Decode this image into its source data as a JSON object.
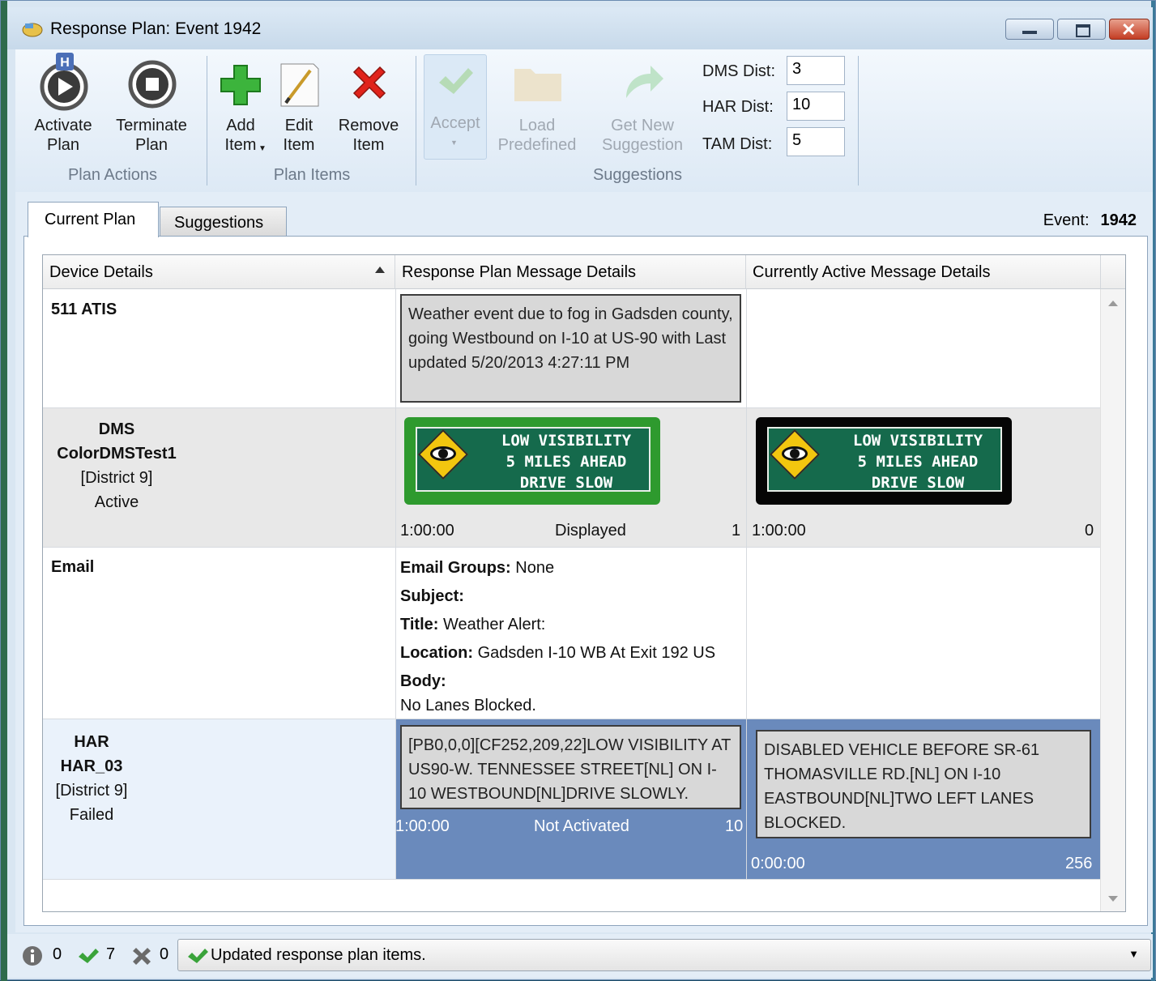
{
  "window": {
    "title": "Response Plan: Event 1942"
  },
  "ribbon": {
    "activate_plan": "Activate\nPlan",
    "activate_badge": "H",
    "terminate_plan": "Terminate\nPlan",
    "group_plan_actions": "Plan Actions",
    "add_item": "Add\nItem",
    "edit_item": "Edit\nItem",
    "remove_item": "Remove\nItem",
    "group_plan_items": "Plan Items",
    "accept": "Accept",
    "load_predefined": "Load\nPredefined",
    "get_new_suggestion": "Get New\nSuggestion",
    "group_suggestions": "Suggestions",
    "dms_dist_label": "DMS Dist:",
    "dms_dist_value": "3",
    "har_dist_label": "HAR Dist:",
    "har_dist_value": "10",
    "tam_dist_label": "TAM Dist:",
    "tam_dist_value": "5"
  },
  "tabs": {
    "current_plan": "Current Plan",
    "suggestions": "Suggestions"
  },
  "event": {
    "label": "Event:",
    "number": "1942"
  },
  "grid": {
    "headers": [
      "Device Details",
      "Response Plan Message Details",
      "Currently Active Message Details"
    ],
    "rows": {
      "atis": {
        "device": "511 ATIS",
        "plan_message": "Weather event due to fog in Gadsden county, going Westbound on I-10 at US-90 with Last updated 5/20/2013 4:27:11 PM"
      },
      "dms": {
        "type": "DMS",
        "name": "ColorDMSTest1",
        "district": "[District 9]",
        "status": "Active",
        "plan_sign_lines": [
          "LOW VISIBILITY",
          "5 MILES AHEAD",
          "DRIVE SLOW"
        ],
        "plan_duration": "1:00:00",
        "plan_state": "Displayed",
        "plan_priority": "1",
        "active_sign_lines": [
          "LOW VISIBILITY",
          "5 MILES AHEAD",
          "DRIVE SLOW"
        ],
        "active_duration": "1:00:00",
        "active_priority": "0"
      },
      "email": {
        "device": "Email",
        "groups_label": "Email Groups:",
        "groups_value": "None",
        "subject_label": "Subject:",
        "title_label": "Title:",
        "title_value": "Weather Alert:",
        "location_label": "Location:",
        "location_value": "Gadsden I-10 WB At Exit 192 US",
        "body_label": "Body:",
        "body_value": "No Lanes Blocked."
      },
      "har": {
        "type": "HAR",
        "name": "HAR_03",
        "district": "[District 9]",
        "status": "Failed",
        "plan_message": "[PB0,0,0][CF252,209,22]LOW VISIBILITY AT US90-W. TENNESSEE STREET[NL] ON I-10 WESTBOUND[NL]DRIVE SLOWLY.",
        "plan_duration": "1:00:00",
        "plan_state": "Not Activated",
        "plan_priority": "10",
        "active_message": "DISABLED VEHICLE BEFORE SR-61 THOMASVILLE RD.[NL] ON I-10 EASTBOUND[NL]TWO LEFT LANES BLOCKED.",
        "active_duration": "0:00:00",
        "active_priority": "256"
      }
    }
  },
  "status": {
    "info_count": "0",
    "ok_count": "7",
    "error_count": "0",
    "message": "Updated response plan items."
  },
  "colors": {
    "selected_row": "#6a8abc",
    "sign_green": "#2e9a2e",
    "sign_black": "#050505",
    "sign_face": "#156a4c"
  }
}
